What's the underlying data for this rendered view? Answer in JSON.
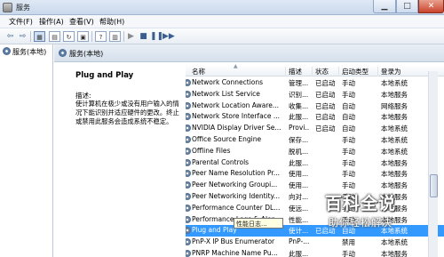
{
  "window": {
    "title": "服务"
  },
  "menu": {
    "file": "文件(F)",
    "action": "操作(A)",
    "view": "查看(V)",
    "help": "帮助(H)"
  },
  "tree": {
    "root": "服务(本地)"
  },
  "header": {
    "title": "服务(本地)"
  },
  "selected_service": {
    "name": "Plug and Play",
    "desc_label": "描述:",
    "description": "使计算机在极少或没有用户输入的情况下能识别并适应硬件的更改。终止或禁用此服务会造成系统不稳定。"
  },
  "columns": {
    "name": "名称",
    "desc": "描述",
    "status": "状态",
    "startup": "启动类型",
    "logon": "登录为"
  },
  "services": [
    {
      "name": "Network Connections",
      "desc": "管理...",
      "status": "已启动",
      "startup": "手动",
      "logon": "本地系统"
    },
    {
      "name": "Network List Service",
      "desc": "识别...",
      "status": "已启动",
      "startup": "手动",
      "logon": "本地服务"
    },
    {
      "name": "Network Location Aware...",
      "desc": "收集...",
      "status": "已启动",
      "startup": "自动",
      "logon": "网络服务"
    },
    {
      "name": "Network Store Interface ...",
      "desc": "此服...",
      "status": "已启动",
      "startup": "自动",
      "logon": "本地服务"
    },
    {
      "name": "NVIDIA Display Driver Se...",
      "desc": "Provi...",
      "status": "已启动",
      "startup": "自动",
      "logon": "本地系统"
    },
    {
      "name": "Office Source Engine",
      "desc": "保存...",
      "status": "",
      "startup": "手动",
      "logon": "本地系统"
    },
    {
      "name": "Offline Files",
      "desc": "脱机...",
      "status": "",
      "startup": "手动",
      "logon": "本地系统"
    },
    {
      "name": "Parental Controls",
      "desc": "此服...",
      "status": "",
      "startup": "手动",
      "logon": "本地服务"
    },
    {
      "name": "Peer Name Resolution Pr...",
      "desc": "使用...",
      "status": "",
      "startup": "手动",
      "logon": "本地服务"
    },
    {
      "name": "Peer Networking Groupi...",
      "desc": "使用...",
      "status": "",
      "startup": "手动",
      "logon": "本地服务"
    },
    {
      "name": "Peer Networking Identity...",
      "desc": "向对...",
      "status": "",
      "startup": "手动",
      "logon": "本地服务"
    },
    {
      "name": "Performance Counter DL...",
      "desc": "使远...",
      "status": "",
      "startup": "手动",
      "logon": "本地服务"
    },
    {
      "name": "Performance Logs & Aler...",
      "desc": "性能...",
      "status": "",
      "startup": "手动",
      "logon": "本地服务"
    },
    {
      "name": "Plug and Play",
      "desc": "使计...",
      "status": "已启动",
      "startup": "自动",
      "logon": "本地系统",
      "selected": true
    },
    {
      "name": "PnP-X IP Bus Enumerator",
      "desc": "PnP-...",
      "status": "",
      "startup": "禁用",
      "logon": "本地系统"
    },
    {
      "name": "PNRP Machine Name Pu...",
      "desc": "此服...",
      "status": "",
      "startup": "手动",
      "logon": "本地服务"
    }
  ],
  "tooltip": {
    "text": "性能日志..."
  },
  "watermark": {
    "main": "百科全说",
    "sub": "助你轻松解决"
  }
}
